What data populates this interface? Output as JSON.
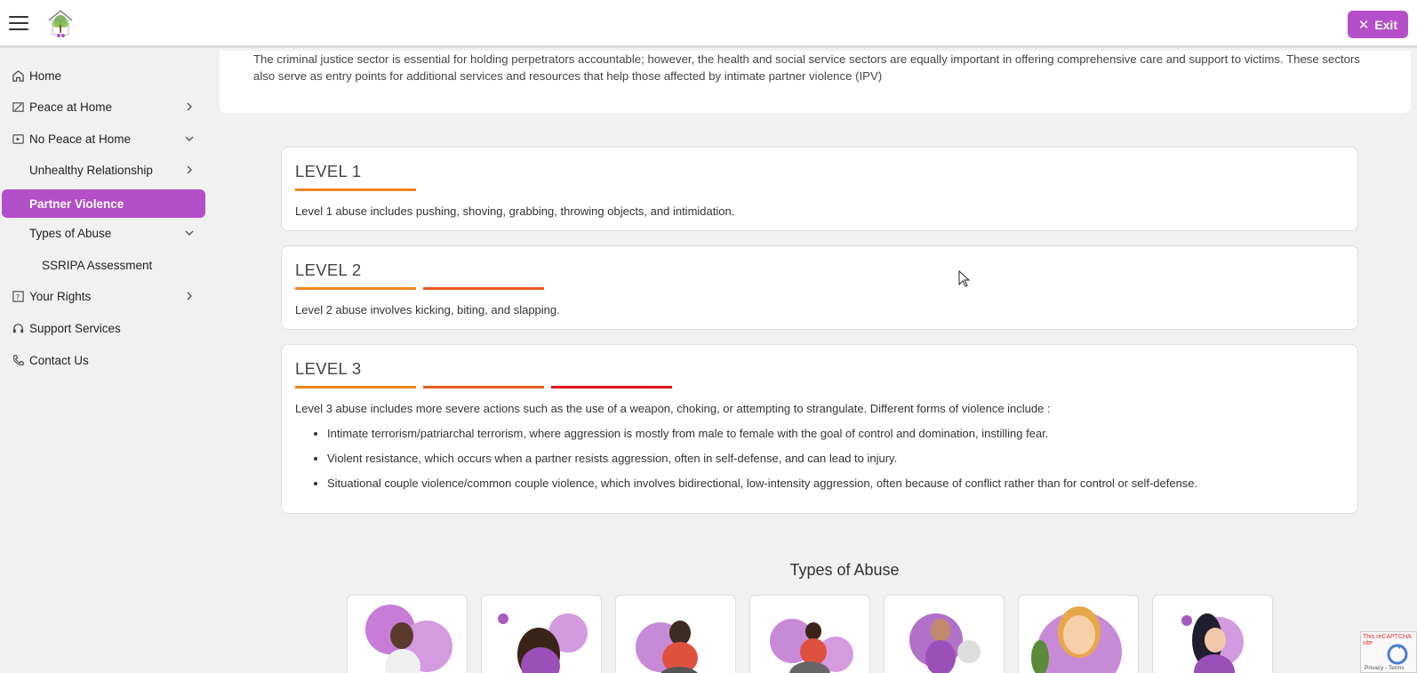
{
  "header": {
    "exit_label": "Exit",
    "menu_icon": "hamburger-icon",
    "logo_icon": "tree-house-logo"
  },
  "sidebar": {
    "items": [
      {
        "label": "Home",
        "icon": "home-icon"
      },
      {
        "label": "Peace at Home",
        "icon": "peace-icon",
        "chevron": "right"
      },
      {
        "label": "No Peace at Home",
        "icon": "video-icon",
        "chevron": "down"
      },
      {
        "label": "Unhealthy Relationship",
        "chevron": "right"
      },
      {
        "label": "Partner Violence",
        "active": true
      },
      {
        "label": "Types of Abuse",
        "chevron": "down"
      },
      {
        "label": "SSRIPA Assessment"
      },
      {
        "label": "Your Rights",
        "icon": "rights-icon",
        "chevron": "right"
      },
      {
        "label": "Support Services",
        "icon": "support-icon"
      },
      {
        "label": "Contact Us",
        "icon": "phone-icon"
      }
    ],
    "active_color": "#b44fc9"
  },
  "intro": {
    "text": "The criminal justice sector is essential for holding perpetrators accountable; however, the health and social service sectors are equally important in offering comprehensive care and support to victims. These sectors also serve as entry points for additional services and resources that help those affected by intimate partner violence (IPV)"
  },
  "levels": [
    {
      "title": "LEVEL 1",
      "desc": "Level 1 abuse includes pushing, shoving, grabbing, throwing objects, and intimidation."
    },
    {
      "title": "LEVEL 2",
      "desc": "Level 2 abuse involves kicking, biting, and slapping."
    },
    {
      "title": "LEVEL 3",
      "desc": "Level 3 abuse includes more severe actions such as the use of a weapon, choking, or attempting to strangulate. Different forms of violence include :",
      "items": [
        "Intimate terrorism/patriarchal terrorism, where aggression is mostly from male to female with the goal of control and domination, instilling fear.",
        "Violent resistance, which occurs when a partner resists aggression, often in self-defense, and can lead to injury.",
        "Situational couple violence/common couple violence, which involves bidirectional, low-intensity aggression, often because of conflict rather than for control or self-defense."
      ]
    }
  ],
  "bar_colors": [
    "#f0841c",
    "#ec5a1e",
    "#e8161c"
  ],
  "types_section": {
    "title": "Types of Abuse"
  },
  "captcha": {
    "text": "This reCAPTCHA site",
    "terms": "Privacy - Terms"
  }
}
